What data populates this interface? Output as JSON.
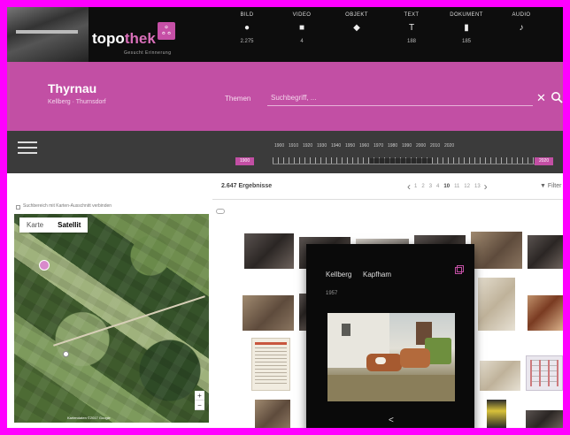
{
  "brand": {
    "name_a": "topo",
    "name_b": "thek",
    "mark": "ஃ",
    "tagline": "Gesucht Erinnerung"
  },
  "media_nav": [
    {
      "label": "BILD",
      "icon": "circle-icon",
      "glyph": "●",
      "count": "2.275"
    },
    {
      "label": "VIDEO",
      "icon": "video-icon",
      "glyph": "■",
      "count": "4"
    },
    {
      "label": "OBJEKT",
      "icon": "object-icon",
      "glyph": "◆",
      "count": ""
    },
    {
      "label": "TEXT",
      "icon": "text-icon",
      "glyph": "T",
      "count": "188"
    },
    {
      "label": "DOKUMENT",
      "icon": "document-icon",
      "glyph": "▮",
      "count": "185"
    },
    {
      "label": "AUDIO",
      "icon": "audio-icon",
      "glyph": "♪",
      "count": ""
    }
  ],
  "place": {
    "name": "Thyrnau",
    "sub": "Kellberg · Thurnsdorf"
  },
  "search": {
    "topics_label": "Themen",
    "placeholder": "Suchbegriff, ...",
    "clear_glyph": "✕"
  },
  "timeline": {
    "years": [
      "1900",
      "1910",
      "1920",
      "1930",
      "1940",
      "1950",
      "1960",
      "1970",
      "1980",
      "1990",
      "2000",
      "2010",
      "2020"
    ],
    "from_label": "1900",
    "to_label": "2020"
  },
  "map": {
    "checkbox_label": "Suchbereich mit Karten-Ausschnitt verbinden",
    "tab_map": "Karte",
    "tab_satellite": "Satellit",
    "zoom_in": "+",
    "zoom_out": "−",
    "footer": "Kartendaten ©2017 Google"
  },
  "results": {
    "count": "2.647 Ergebnisse",
    "prev": "‹",
    "next": "›",
    "pages": [
      "1",
      "2",
      "3",
      "4",
      "10",
      "11",
      "12",
      "13"
    ],
    "current_page": "10",
    "filter_label": "▼ Filter"
  },
  "popup": {
    "location": "Kellberg",
    "title": "Kapfham",
    "date": "1957",
    "share_glyph": "<"
  }
}
